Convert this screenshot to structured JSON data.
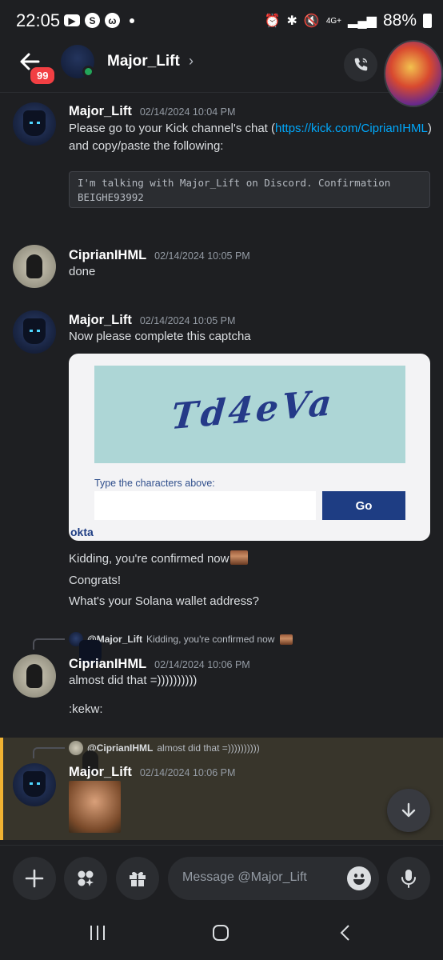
{
  "status_bar": {
    "time": "22:05",
    "battery": "88%",
    "network": "4G+"
  },
  "header": {
    "back_badge": "99",
    "title": "Major_Lift",
    "chevron": "›"
  },
  "messages": {
    "m1": {
      "author": "Major_Lift",
      "timestamp": "02/14/2024 10:04 PM",
      "text_before_link": "Please go to your Kick channel's chat (",
      "link": "https://kick.com/CiprianIHML",
      "text_after_link": ")",
      "line2": "and copy/paste the following:",
      "code_line1": "I'm talking with Major_Lift on Discord. Confirmation",
      "code_line2": "BEIGHE93992"
    },
    "m2": {
      "author": "CiprianIHML",
      "timestamp": "02/14/2024 10:05 PM",
      "text": "done"
    },
    "m3": {
      "author": "Major_Lift",
      "timestamp": "02/14/2024 10:05 PM",
      "text": "Now please complete this captcha",
      "captcha": {
        "image_text": "Td4eVa",
        "label": "Type the characters above:",
        "input_value": "",
        "button": "Go",
        "brand": "okta"
      },
      "followups": [
        "Kidding, you're confirmed now",
        "Congrats!",
        "What's your Solana wallet address?"
      ]
    },
    "m4": {
      "reply_to_author": "@Major_Lift",
      "reply_to_text": "Kidding, you're confirmed now",
      "author": "CiprianIHML",
      "timestamp": "02/14/2024 10:06 PM",
      "text": "almost did that =))))))))))",
      "text2": ":kekw:"
    },
    "m5": {
      "reply_to_author": "@CiprianIHML",
      "reply_to_text": "almost did that =))))))))))",
      "author": "Major_Lift",
      "timestamp": "02/14/2024 10:06 PM"
    }
  },
  "composer": {
    "placeholder": "Message @Major_Lift"
  },
  "icons": {
    "back": "arrow-left-icon",
    "call": "phone-icon",
    "add": "plus-icon",
    "apps": "apps-icon",
    "gift": "gift-icon",
    "emoji": "emoji-icon",
    "mic": "microphone-icon",
    "scroll": "arrow-down-icon"
  },
  "colors": {
    "background": "#1e1f22",
    "link": "#00a8fc",
    "highlight": "#f0b232",
    "online": "#23a55a",
    "badge": "#f23f43",
    "captcha_button": "#1e3d83"
  }
}
